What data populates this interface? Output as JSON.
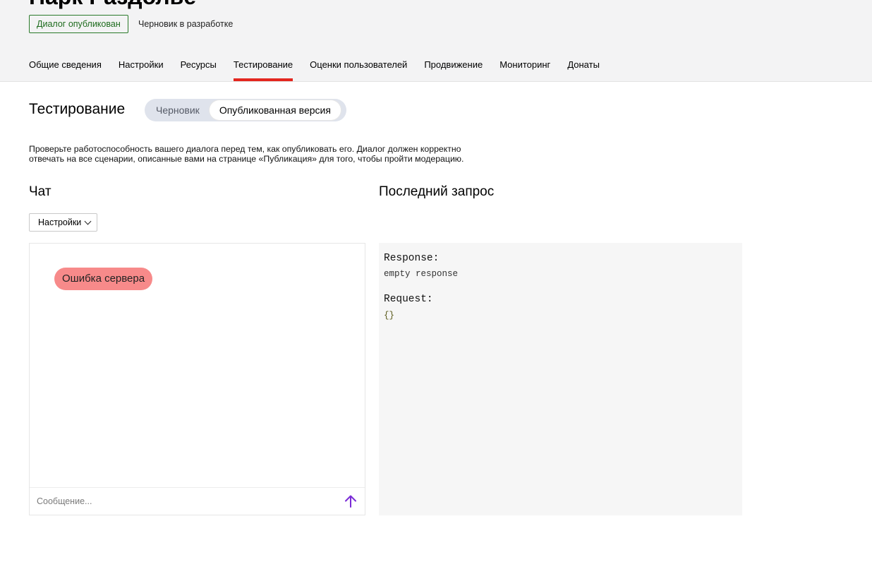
{
  "app": {
    "title": "Парк Раздолье",
    "status_badge": "Диалог опубликован",
    "draft_status": "Черновик в разработке"
  },
  "tabs": [
    {
      "label": "Общие сведения",
      "active": false
    },
    {
      "label": "Настройки",
      "active": false
    },
    {
      "label": "Ресурсы",
      "active": false
    },
    {
      "label": "Тестирование",
      "active": true
    },
    {
      "label": "Оценки пользователей",
      "active": false
    },
    {
      "label": "Продвижение",
      "active": false
    },
    {
      "label": "Мониторинг",
      "active": false
    },
    {
      "label": "Донаты",
      "active": false
    }
  ],
  "testing": {
    "title": "Тестирование",
    "switch": {
      "options": [
        "Черновик",
        "Опубликованная версия"
      ],
      "selected": "Опубликованная версия"
    },
    "description_line1": "Проверьте работоспособность вашего диалога перед тем, как опубликовать его. Диалог должен корректно",
    "description_line2": "отвечать на все сценарии, описанные вами на странице «Публикация» для того, чтобы пройти модерацию."
  },
  "chat": {
    "title": "Чат",
    "settings_label": "Настройки",
    "messages": [
      "Ошибка сервера"
    ],
    "input_placeholder": "Сообщение...",
    "input_value": ""
  },
  "last_request": {
    "title": "Последний запрос",
    "response_label": "Response:",
    "response_value": "empty response",
    "request_label": "Request:",
    "request_value": "{}"
  },
  "colors": {
    "active_tab_underline": "#e3261f",
    "status_badge": "#1d6b1d",
    "error_bubble": "#f78a8a",
    "send_icon": "#7a2bd6"
  },
  "icons": {
    "settings_dropdown": "chevron-down-icon",
    "send": "arrow-up-icon"
  }
}
